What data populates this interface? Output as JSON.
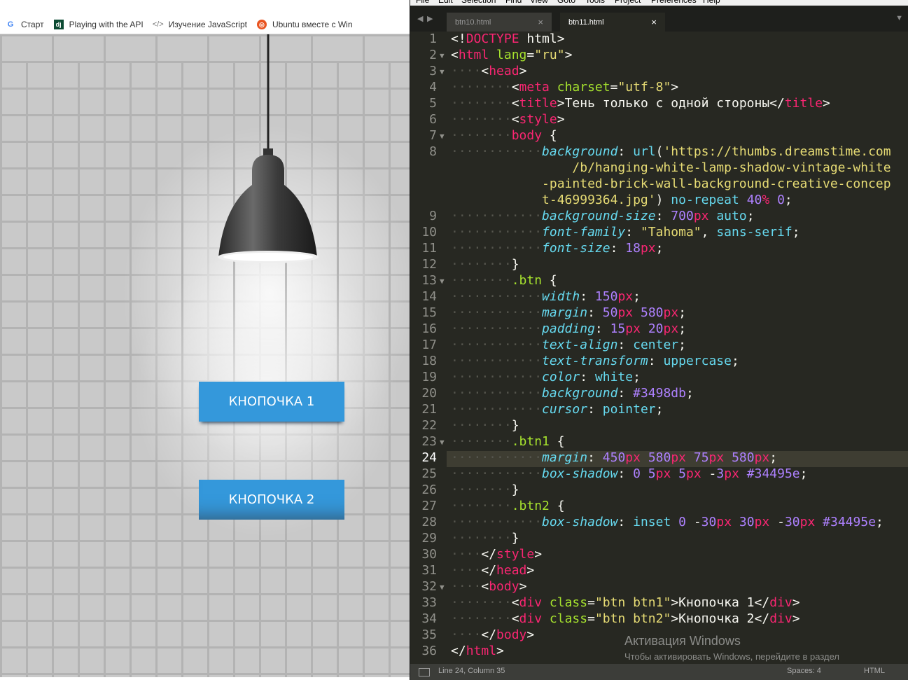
{
  "bookmarks": [
    {
      "icon": "google-icon",
      "label": "Старт"
    },
    {
      "icon": "dj-icon",
      "label": "Playing with the API"
    },
    {
      "icon": "code-icon",
      "label": "Изучение JavaScript"
    },
    {
      "icon": "ubuntu-icon",
      "label": "Ubuntu вместе с Win"
    }
  ],
  "page": {
    "buttons": [
      "Кнопочка 1",
      "Кнопочка 2"
    ],
    "button_color": "#3498db",
    "shadow_color": "#34495e"
  },
  "editor": {
    "menu": [
      "File",
      "Edit",
      "Selection",
      "Find",
      "View",
      "Goto",
      "Tools",
      "Project",
      "Preferences",
      "Help"
    ],
    "tabs": [
      {
        "name": "btn10.html",
        "active": false
      },
      {
        "name": "btn11.html",
        "active": true
      }
    ],
    "current_line": 24,
    "status": {
      "position": "Line 24, Column 35",
      "spaces": "Spaces: 4",
      "syntax": "HTML"
    },
    "activation": {
      "title": "Активация Windows",
      "message": "Чтобы активировать Windows, перейдите в раздел \"Параметры\"."
    },
    "theme": {
      "background": "#272822",
      "tag": "#f92672",
      "attr": "#a6e22e",
      "string": "#e6db74",
      "prop": "#66d9ef",
      "number": "#ae81ff"
    },
    "lines": [
      {
        "n": "1",
        "fold": false,
        "indent": 0,
        "code": [
          [
            "p",
            "<!"
          ],
          [
            "t",
            "DOCTYPE"
          ],
          [
            "p",
            " html>"
          ]
        ]
      },
      {
        "n": "2",
        "fold": true,
        "indent": 0,
        "code": [
          [
            "p",
            "<"
          ],
          [
            "t",
            "html"
          ],
          [
            "p",
            " "
          ],
          [
            "a",
            "lang"
          ],
          [
            "p",
            "="
          ],
          [
            "s",
            "\"ru\""
          ],
          [
            "p",
            ">"
          ]
        ]
      },
      {
        "n": "3",
        "fold": true,
        "indent": 1,
        "code": [
          [
            "p",
            "<"
          ],
          [
            "t",
            "head"
          ],
          [
            "p",
            ">"
          ]
        ]
      },
      {
        "n": "4",
        "fold": false,
        "indent": 2,
        "code": [
          [
            "p",
            "<"
          ],
          [
            "t",
            "meta"
          ],
          [
            "p",
            " "
          ],
          [
            "a",
            "charset"
          ],
          [
            "p",
            "="
          ],
          [
            "s",
            "\"utf-8\""
          ],
          [
            "p",
            ">"
          ]
        ]
      },
      {
        "n": "5",
        "fold": false,
        "indent": 2,
        "code": [
          [
            "p",
            "<"
          ],
          [
            "t",
            "title"
          ],
          [
            "p",
            ">Тень только с одной стороны</"
          ],
          [
            "t",
            "title"
          ],
          [
            "p",
            ">"
          ]
        ]
      },
      {
        "n": "6",
        "fold": false,
        "indent": 2,
        "code": [
          [
            "p",
            "<"
          ],
          [
            "t",
            "style"
          ],
          [
            "p",
            ">"
          ]
        ]
      },
      {
        "n": "7",
        "fold": true,
        "indent": 2,
        "code": [
          [
            "t",
            "body"
          ],
          [
            "p",
            " {"
          ]
        ]
      },
      {
        "n": "8",
        "fold": false,
        "indent": 3,
        "code": [
          [
            "k",
            "background"
          ],
          [
            "p",
            ": "
          ],
          [
            "v",
            "url"
          ],
          [
            "p",
            "("
          ],
          [
            "s",
            "'https://thumbs.dreamstime.com"
          ]
        ]
      },
      {
        "n": "",
        "fold": false,
        "indent": 4,
        "code": [
          [
            "s",
            "/b/hanging-white-lamp-shadow-vintage-white"
          ]
        ]
      },
      {
        "n": "",
        "fold": false,
        "indent": 3,
        "code": [
          [
            "s",
            "-painted-brick-wall-background-creative-concep"
          ]
        ]
      },
      {
        "n": "",
        "fold": false,
        "indent": 3,
        "code": [
          [
            "s",
            "t-46999364.jpg'"
          ],
          [
            "p",
            ") "
          ],
          [
            "v",
            "no-repeat"
          ],
          [
            "p",
            " "
          ],
          [
            "n",
            "40"
          ],
          [
            "u",
            "%"
          ],
          [
            "p",
            " "
          ],
          [
            "n",
            "0"
          ],
          [
            "p",
            ";"
          ]
        ]
      },
      {
        "n": "9",
        "fold": false,
        "indent": 3,
        "code": [
          [
            "k",
            "background-size"
          ],
          [
            "p",
            ": "
          ],
          [
            "n",
            "700"
          ],
          [
            "u",
            "px"
          ],
          [
            "p",
            " "
          ],
          [
            "v",
            "auto"
          ],
          [
            "p",
            ";"
          ]
        ]
      },
      {
        "n": "10",
        "fold": false,
        "indent": 3,
        "code": [
          [
            "k",
            "font-family"
          ],
          [
            "p",
            ": "
          ],
          [
            "s",
            "\"Tahoma\""
          ],
          [
            "p",
            ", "
          ],
          [
            "v",
            "sans-serif"
          ],
          [
            "p",
            ";"
          ]
        ]
      },
      {
        "n": "11",
        "fold": false,
        "indent": 3,
        "code": [
          [
            "k",
            "font-size"
          ],
          [
            "p",
            ": "
          ],
          [
            "n",
            "18"
          ],
          [
            "u",
            "px"
          ],
          [
            "p",
            ";"
          ]
        ]
      },
      {
        "n": "12",
        "fold": false,
        "indent": 2,
        "code": [
          [
            "p",
            "}"
          ]
        ]
      },
      {
        "n": "13",
        "fold": true,
        "indent": 2,
        "code": [
          [
            "a",
            ".btn"
          ],
          [
            "p",
            " {"
          ]
        ]
      },
      {
        "n": "14",
        "fold": false,
        "indent": 3,
        "code": [
          [
            "k",
            "width"
          ],
          [
            "p",
            ": "
          ],
          [
            "n",
            "150"
          ],
          [
            "u",
            "px"
          ],
          [
            "p",
            ";"
          ]
        ]
      },
      {
        "n": "15",
        "fold": false,
        "indent": 3,
        "code": [
          [
            "k",
            "margin"
          ],
          [
            "p",
            ": "
          ],
          [
            "n",
            "50"
          ],
          [
            "u",
            "px"
          ],
          [
            "p",
            " "
          ],
          [
            "n",
            "580"
          ],
          [
            "u",
            "px"
          ],
          [
            "p",
            ";"
          ]
        ]
      },
      {
        "n": "16",
        "fold": false,
        "indent": 3,
        "code": [
          [
            "k",
            "padding"
          ],
          [
            "p",
            ": "
          ],
          [
            "n",
            "15"
          ],
          [
            "u",
            "px"
          ],
          [
            "p",
            " "
          ],
          [
            "n",
            "20"
          ],
          [
            "u",
            "px"
          ],
          [
            "p",
            ";"
          ]
        ]
      },
      {
        "n": "17",
        "fold": false,
        "indent": 3,
        "code": [
          [
            "k",
            "text-align"
          ],
          [
            "p",
            ": "
          ],
          [
            "v",
            "center"
          ],
          [
            "p",
            ";"
          ]
        ]
      },
      {
        "n": "18",
        "fold": false,
        "indent": 3,
        "code": [
          [
            "k",
            "text-transform"
          ],
          [
            "p",
            ": "
          ],
          [
            "v",
            "uppercase"
          ],
          [
            "p",
            ";"
          ]
        ]
      },
      {
        "n": "19",
        "fold": false,
        "indent": 3,
        "code": [
          [
            "k",
            "color"
          ],
          [
            "p",
            ": "
          ],
          [
            "v",
            "white"
          ],
          [
            "p",
            ";"
          ]
        ]
      },
      {
        "n": "20",
        "fold": false,
        "indent": 3,
        "code": [
          [
            "k",
            "background"
          ],
          [
            "p",
            ": "
          ],
          [
            "n",
            "#3498db"
          ],
          [
            "p",
            ";"
          ]
        ]
      },
      {
        "n": "21",
        "fold": false,
        "indent": 3,
        "code": [
          [
            "k",
            "cursor"
          ],
          [
            "p",
            ": "
          ],
          [
            "v",
            "pointer"
          ],
          [
            "p",
            ";"
          ]
        ]
      },
      {
        "n": "22",
        "fold": false,
        "indent": 2,
        "code": [
          [
            "p",
            "}"
          ]
        ]
      },
      {
        "n": "23",
        "fold": true,
        "indent": 2,
        "code": [
          [
            "a",
            ".btn1"
          ],
          [
            "p",
            " {"
          ]
        ]
      },
      {
        "n": "24",
        "fold": false,
        "indent": 3,
        "code": [
          [
            "k",
            "margin"
          ],
          [
            "p",
            ": "
          ],
          [
            "n",
            "450"
          ],
          [
            "u",
            "px"
          ],
          [
            "p",
            " "
          ],
          [
            "n",
            "580"
          ],
          [
            "u",
            "px"
          ],
          [
            "p",
            " "
          ],
          [
            "n",
            "75"
          ],
          [
            "u",
            "px"
          ],
          [
            "p",
            " "
          ],
          [
            "n",
            "580"
          ],
          [
            "u",
            "px"
          ],
          [
            "p",
            ";"
          ]
        ]
      },
      {
        "n": "25",
        "fold": false,
        "indent": 3,
        "code": [
          [
            "k",
            "box-shadow"
          ],
          [
            "p",
            ": "
          ],
          [
            "n",
            "0"
          ],
          [
            "p",
            " "
          ],
          [
            "n",
            "5"
          ],
          [
            "u",
            "px"
          ],
          [
            "p",
            " "
          ],
          [
            "n",
            "5"
          ],
          [
            "u",
            "px"
          ],
          [
            "p",
            " -"
          ],
          [
            "n",
            "3"
          ],
          [
            "u",
            "px"
          ],
          [
            "p",
            " "
          ],
          [
            "n",
            "#34495e"
          ],
          [
            "p",
            ";"
          ]
        ]
      },
      {
        "n": "26",
        "fold": false,
        "indent": 2,
        "code": [
          [
            "p",
            "}"
          ]
        ]
      },
      {
        "n": "27",
        "fold": false,
        "indent": 2,
        "code": [
          [
            "a",
            ".btn2"
          ],
          [
            "p",
            " {"
          ]
        ]
      },
      {
        "n": "28",
        "fold": false,
        "indent": 3,
        "code": [
          [
            "k",
            "box-shadow"
          ],
          [
            "p",
            ": "
          ],
          [
            "v",
            "inset"
          ],
          [
            "p",
            " "
          ],
          [
            "n",
            "0"
          ],
          [
            "p",
            " -"
          ],
          [
            "n",
            "30"
          ],
          [
            "u",
            "px"
          ],
          [
            "p",
            " "
          ],
          [
            "n",
            "30"
          ],
          [
            "u",
            "px"
          ],
          [
            "p",
            " -"
          ],
          [
            "n",
            "30"
          ],
          [
            "u",
            "px"
          ],
          [
            "p",
            " "
          ],
          [
            "n",
            "#34495e"
          ],
          [
            "p",
            ";"
          ]
        ]
      },
      {
        "n": "29",
        "fold": false,
        "indent": 2,
        "code": [
          [
            "p",
            "}"
          ]
        ]
      },
      {
        "n": "30",
        "fold": false,
        "indent": 1,
        "code": [
          [
            "p",
            "</"
          ],
          [
            "t",
            "style"
          ],
          [
            "p",
            ">"
          ]
        ]
      },
      {
        "n": "31",
        "fold": false,
        "indent": 1,
        "code": [
          [
            "p",
            "</"
          ],
          [
            "t",
            "head"
          ],
          [
            "p",
            ">"
          ]
        ]
      },
      {
        "n": "32",
        "fold": true,
        "indent": 1,
        "code": [
          [
            "p",
            "<"
          ],
          [
            "t",
            "body"
          ],
          [
            "p",
            ">"
          ]
        ]
      },
      {
        "n": "33",
        "fold": false,
        "indent": 2,
        "code": [
          [
            "p",
            "<"
          ],
          [
            "t",
            "div"
          ],
          [
            "p",
            " "
          ],
          [
            "a",
            "class"
          ],
          [
            "p",
            "="
          ],
          [
            "s",
            "\"btn btn1\""
          ],
          [
            "p",
            ">Кнопочка 1</"
          ],
          [
            "t",
            "div"
          ],
          [
            "p",
            ">"
          ]
        ]
      },
      {
        "n": "34",
        "fold": false,
        "indent": 2,
        "code": [
          [
            "p",
            "<"
          ],
          [
            "t",
            "div"
          ],
          [
            "p",
            " "
          ],
          [
            "a",
            "class"
          ],
          [
            "p",
            "="
          ],
          [
            "s",
            "\"btn btn2\""
          ],
          [
            "p",
            ">Кнопочка 2</"
          ],
          [
            "t",
            "div"
          ],
          [
            "p",
            ">"
          ]
        ]
      },
      {
        "n": "35",
        "fold": false,
        "indent": 1,
        "code": [
          [
            "p",
            "</"
          ],
          [
            "t",
            "body"
          ],
          [
            "p",
            ">"
          ]
        ]
      },
      {
        "n": "36",
        "fold": false,
        "indent": 0,
        "code": [
          [
            "p",
            "</"
          ],
          [
            "t",
            "html"
          ],
          [
            "p",
            ">"
          ]
        ]
      }
    ]
  }
}
